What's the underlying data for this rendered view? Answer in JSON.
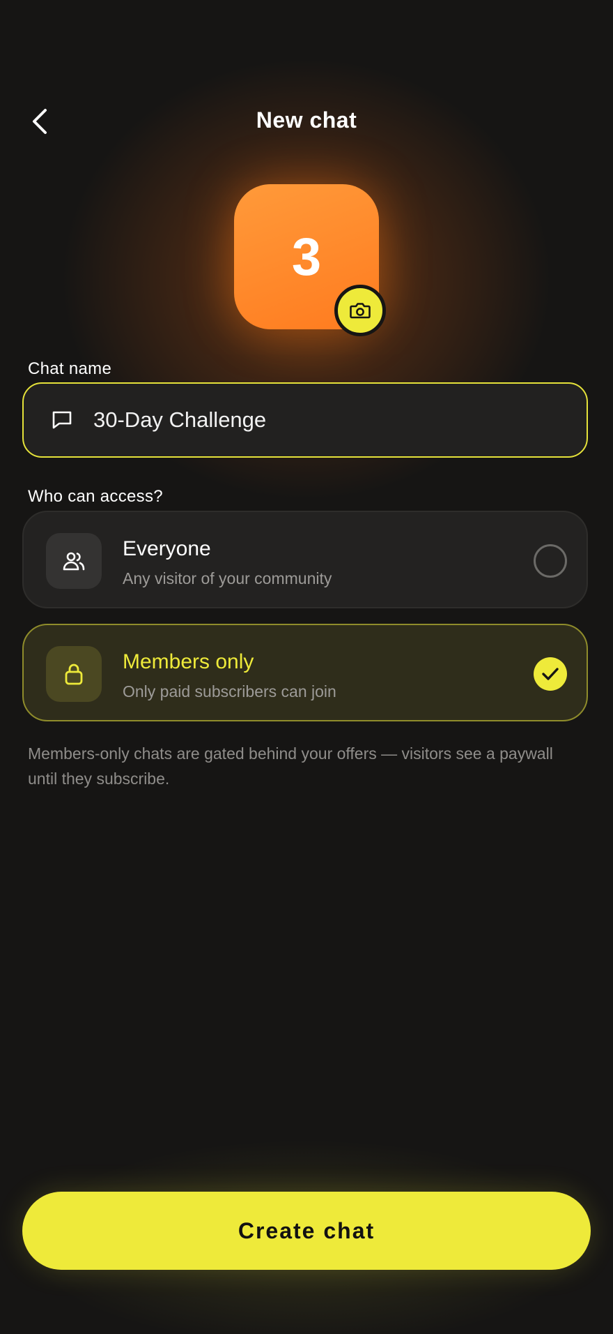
{
  "header": {
    "title": "New chat",
    "back_icon": "chevron-left-icon"
  },
  "avatar": {
    "initial": "3",
    "background": "#ff8a2a",
    "camera_icon": "camera-icon"
  },
  "chat_name": {
    "label": "Chat name",
    "value": "30-Day Challenge",
    "icon": "message-square-icon"
  },
  "access": {
    "label": "Who can access?",
    "options": [
      {
        "title": "Everyone",
        "subtitle": "Any visitor of your community",
        "icon": "users-icon",
        "selected": false
      },
      {
        "title": "Members only",
        "subtitle": "Only paid subscribers can join",
        "icon": "lock-icon",
        "selected": true
      }
    ],
    "note": "Members-only chats are gated behind your offers — visitors see a paywall until they subscribe."
  },
  "cta": {
    "label": "Create chat"
  },
  "colors": {
    "accent": "#eeea3a",
    "background": "#161514",
    "avatar": "#ff8a2a"
  }
}
